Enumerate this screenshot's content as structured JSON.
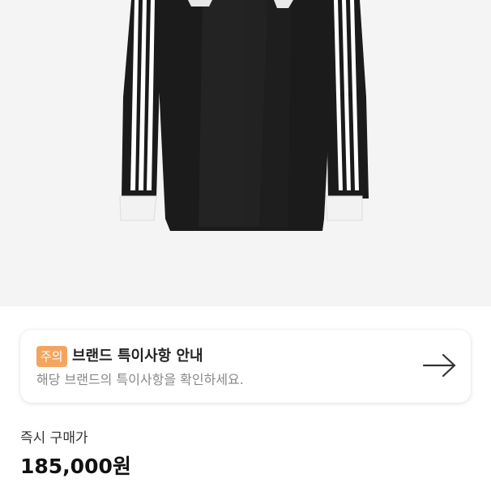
{
  "product": {
    "image_icon": "black-track-jersey-with-white-stripes"
  },
  "notice": {
    "badge": "주의",
    "title": "브랜드 특이사항 안내",
    "description": "해당 브랜드의 특이사항을 확인하세요.",
    "arrow_icon": "arrow-right-icon",
    "badge_color": "#f3a55f"
  },
  "price": {
    "label": "즉시 구매가",
    "value": "185,000원"
  }
}
